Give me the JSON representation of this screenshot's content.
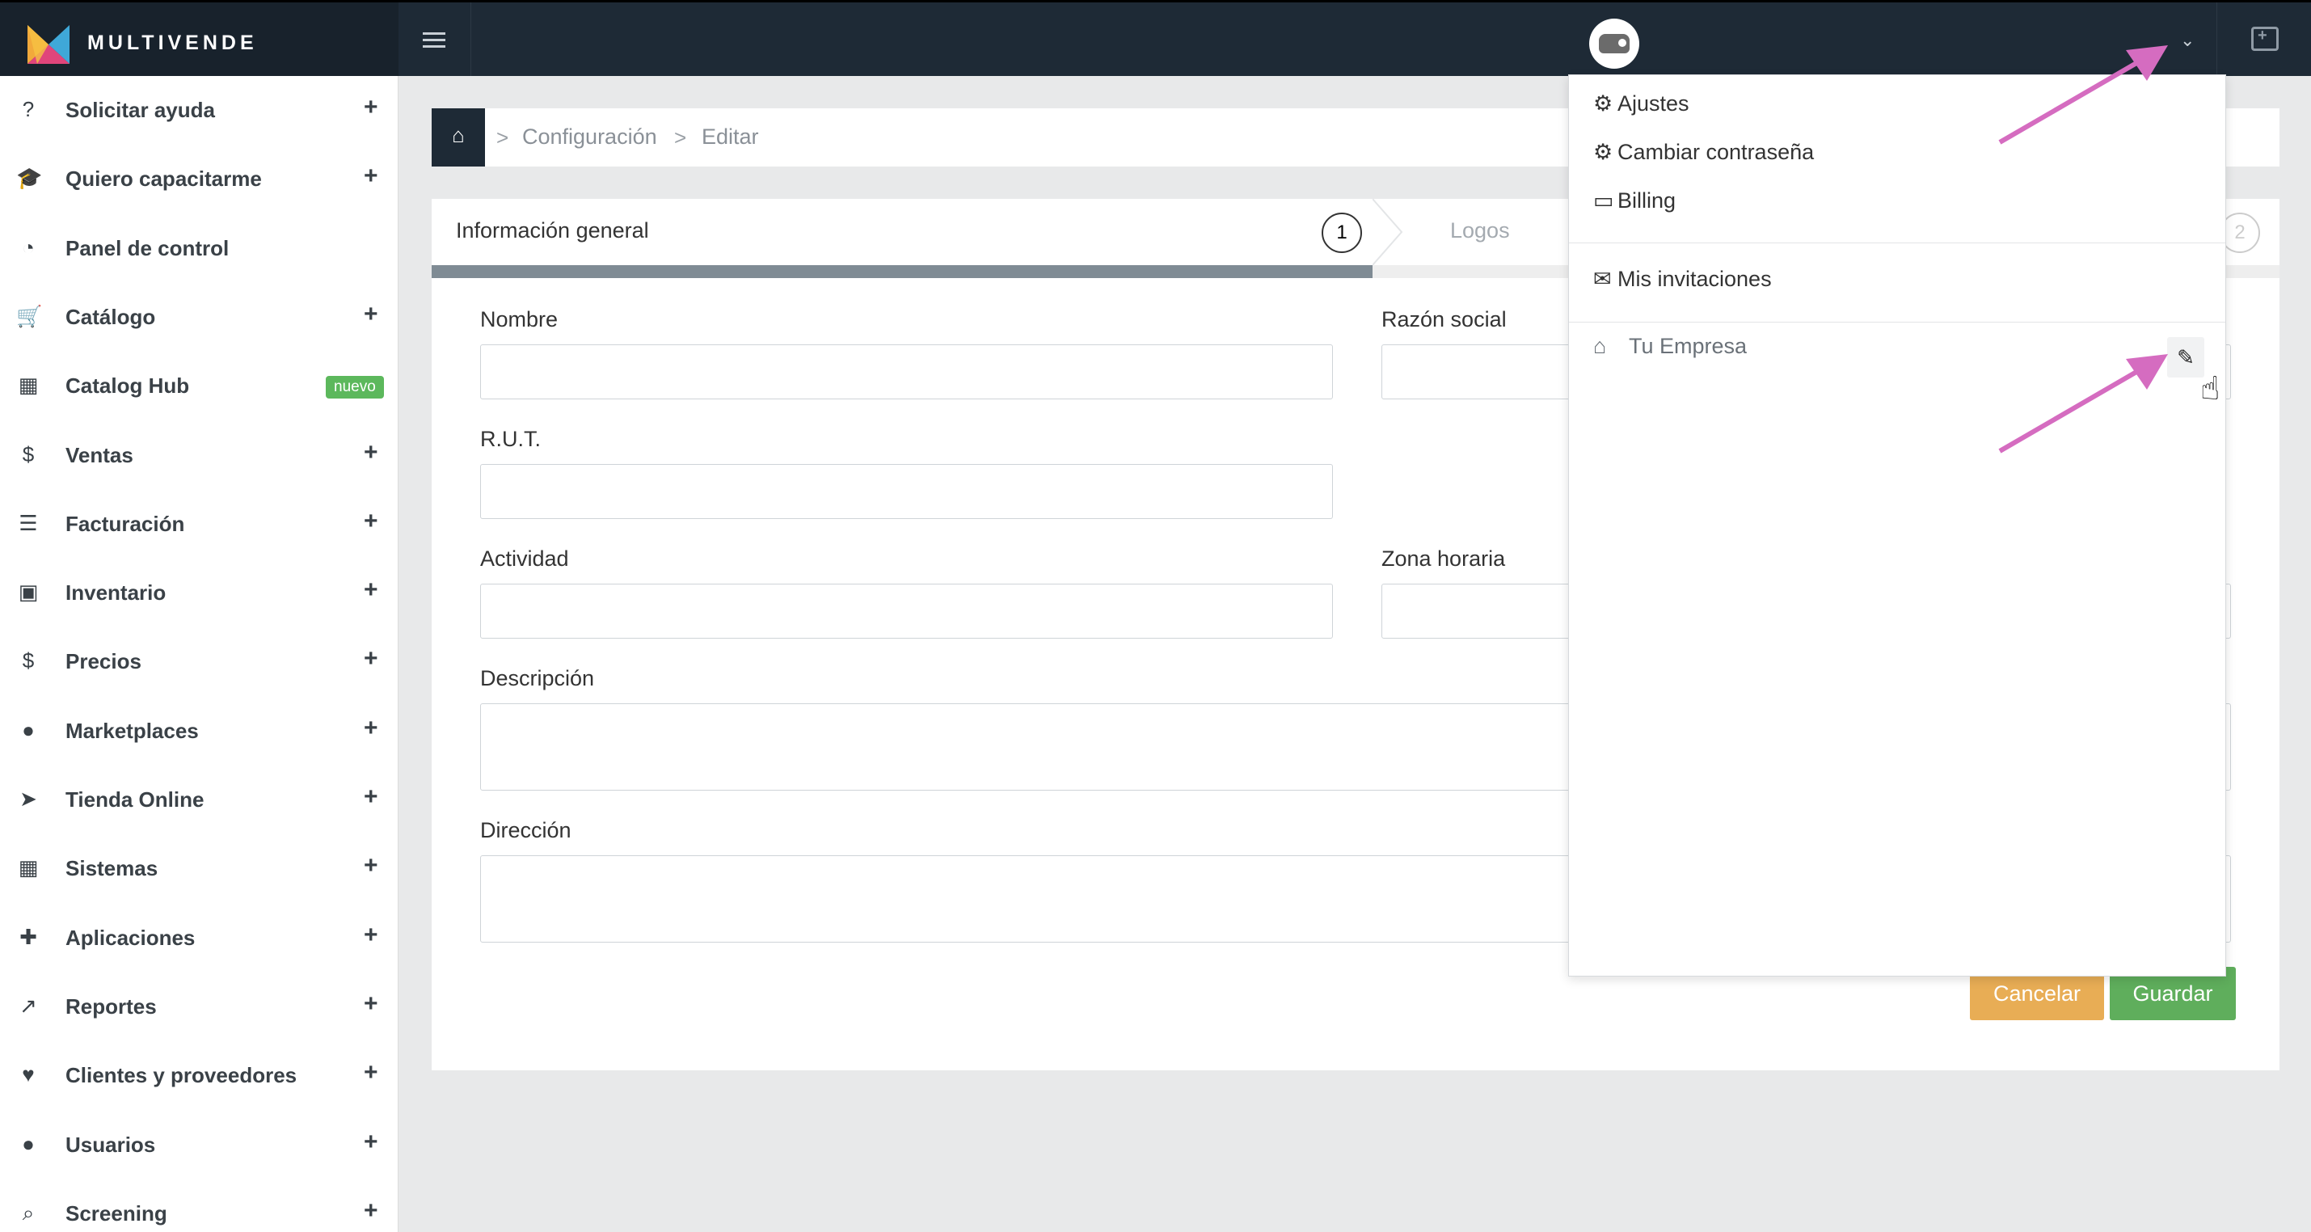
{
  "app": {
    "brand": "MULTIVENDE"
  },
  "sidebar": {
    "items": [
      {
        "label": "Solicitar ayuda",
        "icon": "question-circle-icon",
        "glyph": "?",
        "expandable": true
      },
      {
        "label": "Quiero capacitarme",
        "icon": "graduation-cap-icon",
        "glyph": "🎓",
        "expandable": true
      },
      {
        "label": "Panel de control",
        "icon": "dashboard-icon",
        "glyph": "◔",
        "expandable": false
      },
      {
        "label": "Catálogo",
        "icon": "shopping-cart-icon",
        "glyph": "🛒",
        "expandable": true
      },
      {
        "label": "Catalog Hub",
        "icon": "grid-icon",
        "glyph": "▦",
        "expandable": false,
        "badge": "nuevo"
      },
      {
        "label": "Ventas",
        "icon": "money-icon",
        "glyph": "$",
        "expandable": true
      },
      {
        "label": "Facturación",
        "icon": "document-icon",
        "glyph": "☰",
        "expandable": true
      },
      {
        "label": "Inventario",
        "icon": "cubes-icon",
        "glyph": "▣",
        "expandable": true
      },
      {
        "label": "Precios",
        "icon": "dollar-icon",
        "glyph": "$",
        "expandable": true
      },
      {
        "label": "Marketplaces",
        "icon": "globe-icon",
        "glyph": "●",
        "expandable": true
      },
      {
        "label": "Tienda Online",
        "icon": "pointer-icon",
        "glyph": "➤",
        "expandable": true
      },
      {
        "label": "Sistemas",
        "icon": "calculator-icon",
        "glyph": "▦",
        "expandable": true
      },
      {
        "label": "Aplicaciones",
        "icon": "puzzle-icon",
        "glyph": "✚",
        "expandable": true
      },
      {
        "label": "Reportes",
        "icon": "line-chart-icon",
        "glyph": "↗",
        "expandable": true
      },
      {
        "label": "Clientes y proveedores",
        "icon": "heart-icon",
        "glyph": "♥",
        "expandable": true
      },
      {
        "label": "Usuarios",
        "icon": "user-icon",
        "glyph": "●",
        "expandable": true
      },
      {
        "label": "Screening",
        "icon": "search-icon",
        "glyph": "⌕",
        "expandable": true
      }
    ],
    "plus": "+"
  },
  "breadcrumb": {
    "home_icon": "home-icon",
    "separator": ">",
    "items": [
      "Configuración",
      "Editar"
    ]
  },
  "wizard": {
    "steps": [
      {
        "label": "Información general",
        "number": "1"
      },
      {
        "label": "Logos",
        "number": "2"
      }
    ]
  },
  "form": {
    "nombre_label": "Nombre",
    "razon_social_label": "Razón social",
    "rut_label": "R.U.T.",
    "actividad_label": "Actividad",
    "zona_horaria_label": "Zona horaria",
    "descripcion_label": "Descripción",
    "direccion_label": "Dirección",
    "cancel_label": "Cancelar",
    "save_label": "Guardar"
  },
  "dropdown": {
    "items": [
      {
        "label": "Ajustes",
        "icon": "gear-icon",
        "glyph": "⚙"
      },
      {
        "label": "Cambiar contraseña",
        "icon": "gear-icon",
        "glyph": "⚙"
      },
      {
        "label": "Billing",
        "icon": "credit-card-icon",
        "glyph": "▭"
      },
      {
        "label": "Mis invitaciones",
        "icon": "envelope-icon",
        "glyph": "✉"
      }
    ],
    "company": {
      "label": "Tu Empresa",
      "icon": "home-icon",
      "glyph": "⌂"
    },
    "edit_icon": "pencil-icon"
  },
  "colors": {
    "topbar": "#1e2a36",
    "accent_arrow": "#d56cc0",
    "cancel": "#e8ad55",
    "save": "#5fae5c",
    "badge": "#5cb85c"
  }
}
